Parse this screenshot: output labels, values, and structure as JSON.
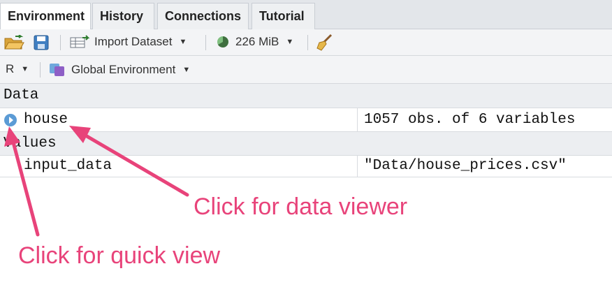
{
  "tabs": [
    {
      "label": "Environment",
      "active": true
    },
    {
      "label": "History",
      "active": false
    },
    {
      "label": "Connections",
      "active": false
    },
    {
      "label": "Tutorial",
      "active": false
    }
  ],
  "toolbar1": {
    "open_icon": "folder-open-icon",
    "save_icon": "save-icon",
    "import_label": "Import Dataset",
    "memory_label": "226 MiB",
    "broom_icon": "broom-icon"
  },
  "toolbar2": {
    "language": "R",
    "environment_label": "Global Environment"
  },
  "env": {
    "data_header": "Data",
    "data_rows": [
      {
        "name": "house",
        "value": "1057 obs. of 6 variables"
      }
    ],
    "values_header": "Values",
    "value_rows": [
      {
        "name": "input_data",
        "value": "\"Data/house_prices.csv\""
      }
    ]
  },
  "annotations": {
    "viewer": "Click for data viewer",
    "quick": "Click for quick view",
    "color": "#e8437a"
  }
}
